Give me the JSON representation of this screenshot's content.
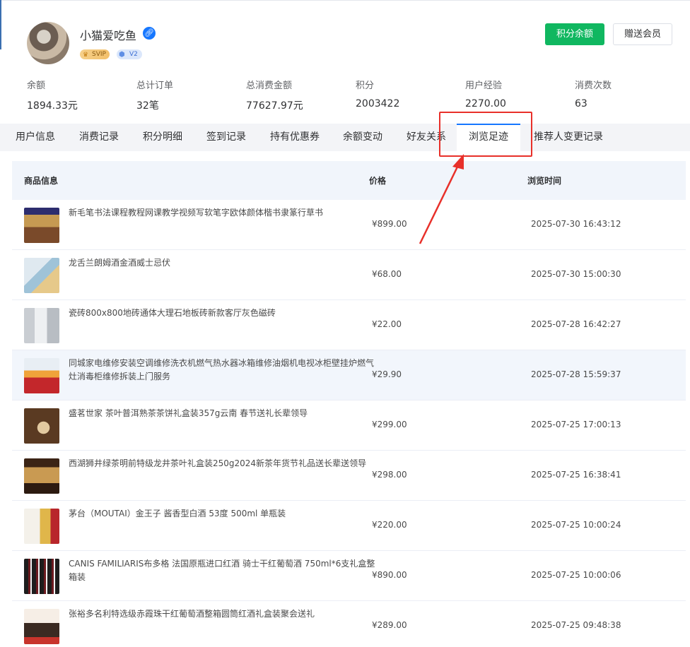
{
  "user": {
    "name": "小猫爱吃鱼",
    "badge_svip": "SVIP",
    "badge_level": "V2",
    "link_icon": "link-icon"
  },
  "actions": {
    "points_balance": "积分余额",
    "gift_member": "赠送会员"
  },
  "stats": [
    {
      "label": "余额",
      "value": "1894.33元"
    },
    {
      "label": "总计订单",
      "value": "32笔"
    },
    {
      "label": "总消费金额",
      "value": "77627.97元"
    },
    {
      "label": "积分",
      "value": "2003422"
    },
    {
      "label": "用户经验",
      "value": "2270.00"
    },
    {
      "label": "消费次数",
      "value": "63"
    }
  ],
  "tabs": [
    "用户信息",
    "消费记录",
    "积分明细",
    "签到记录",
    "持有优惠券",
    "余额变动",
    "好友关系",
    "浏览足迹",
    "推荐人变更记录"
  ],
  "active_tab": "浏览足迹",
  "table": {
    "headers": {
      "product": "商品信息",
      "price": "价格",
      "time": "浏览时间"
    },
    "rows": [
      {
        "name": "新毛笔书法课程教程网课教学视频写软笔字欧体颜体楷书隶篆行草书",
        "price": "¥899.00",
        "time": "2025-07-30 16:43:12"
      },
      {
        "name": "龙舌兰朗姆酒金酒威士忌伏",
        "price": "¥68.00",
        "time": "2025-07-30 15:00:30"
      },
      {
        "name": "瓷砖800x800地砖通体大理石地板砖新款客厅灰色磁砖",
        "price": "¥22.00",
        "time": "2025-07-28 16:42:27"
      },
      {
        "name": "同城家电维修安装空调维修洗衣机燃气热水器冰箱维修油烟机电视冰柜壁挂炉燃气灶消毒柜维修拆装上门服务",
        "price": "¥29.90",
        "time": "2025-07-28 15:59:37"
      },
      {
        "name": "盛茗世家 茶叶普洱熟茶茶饼礼盒装357g云南 春节送礼长辈领导",
        "price": "¥299.00",
        "time": "2025-07-25 17:00:13"
      },
      {
        "name": "西湖狮井绿茶明前特级龙井茶叶礼盒装250g2024新茶年货节礼品送长辈送领导",
        "price": "¥298.00",
        "time": "2025-07-25 16:38:41"
      },
      {
        "name": "茅台（MOUTAI）金王子 酱香型白酒 53度 500ml 单瓶装",
        "price": "¥220.00",
        "time": "2025-07-25 10:00:24"
      },
      {
        "name": "CANIS FAMILIARIS布多格 法国原瓶进口红酒 骑士干红葡萄酒 750ml*6支礼盒整箱装",
        "price": "¥890.00",
        "time": "2025-07-25 10:00:06"
      },
      {
        "name": "张裕多名利特选级赤霞珠干红葡萄酒整箱圆筒红酒礼盒装聚会送礼",
        "price": "¥289.00",
        "time": "2025-07-25 09:48:38"
      }
    ]
  },
  "colors": {
    "primary": "#1677ff",
    "success": "#10b760",
    "annotation": "#e8302a"
  }
}
